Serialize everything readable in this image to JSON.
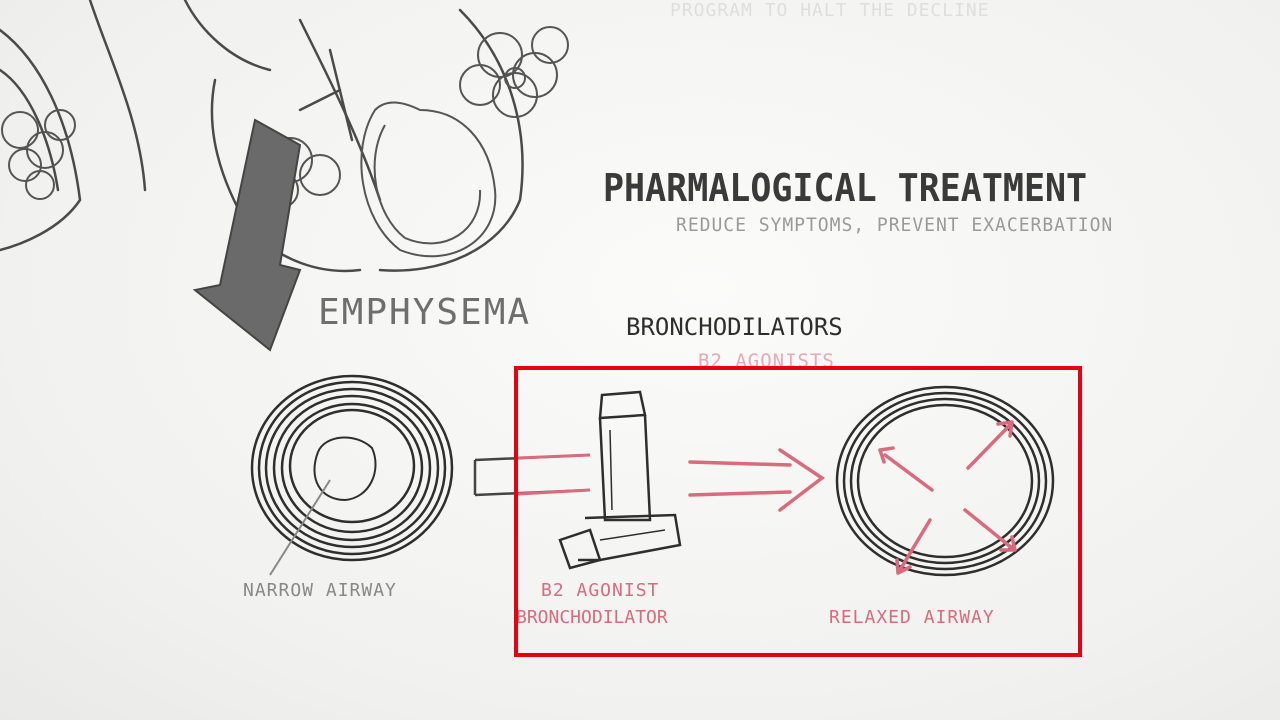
{
  "header": {
    "title": "PHARMALOGICAL TREATMENT",
    "subtitle": "REDUCE SYMPTOMS, PREVENT EXACERBATION"
  },
  "labels": {
    "emphysema": "EMPHYSEMA",
    "bronchodilators": "BRONCHODILATORS",
    "b2_agonists": "B2 AGONISTS",
    "narrow_airway": "NARROW AIRWAY",
    "agonist_line1": "B2 AGONIST",
    "agonist_line2": "BRONCHODILATOR",
    "relaxed_airway": "RELAXED AIRWAY",
    "faint_top": "PROGRAM TO HALT THE DECLINE"
  },
  "colors": {
    "ink": "#333333",
    "pink_ink": "#d96b7d",
    "highlight": "#e60012"
  }
}
